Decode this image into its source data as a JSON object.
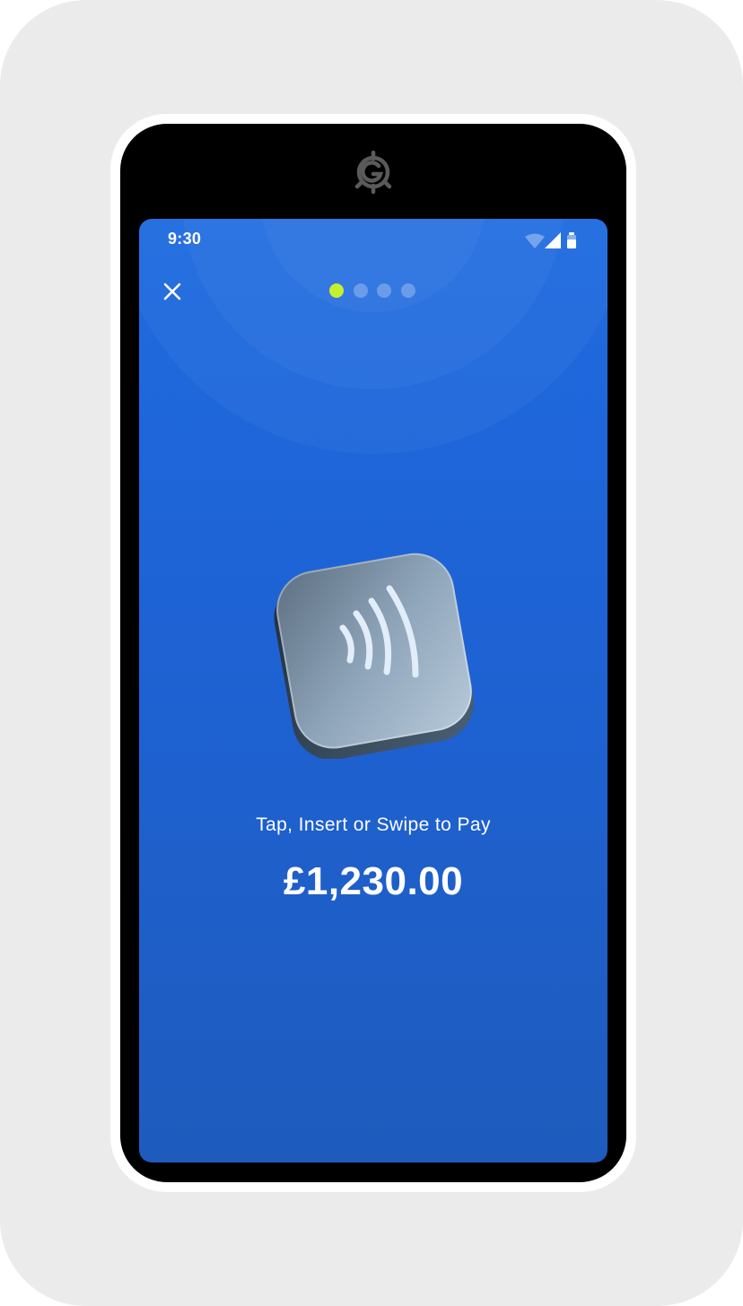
{
  "status_bar": {
    "time": "9:30",
    "icons": [
      "wifi-icon",
      "signal-icon",
      "battery-icon"
    ]
  },
  "header": {
    "close_icon": "close-icon",
    "pager": {
      "total": 4,
      "active_index": 0
    }
  },
  "payment": {
    "prompt": "Tap, Insert or Swipe to Pay",
    "amount": "£1,230.00",
    "illustration_icon": "contactless-icon"
  },
  "colors": {
    "screen_top": "#1f6be0",
    "screen_bottom": "#1e5bbd",
    "pager_active": "#c6f02c",
    "device_body": "#000000",
    "outer_background": "#ebebeb"
  }
}
